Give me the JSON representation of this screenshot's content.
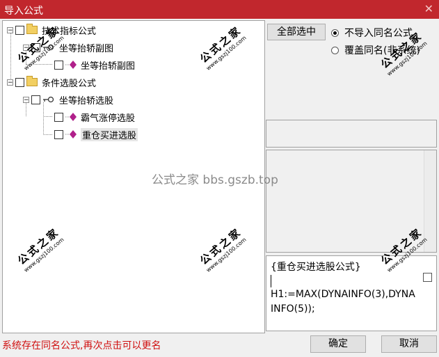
{
  "window": {
    "title": "导入公式",
    "close_glyph": "✕"
  },
  "tree": {
    "nodes": [
      {
        "label": "技术指标公式"
      },
      {
        "label": "坐等抬轿副图"
      },
      {
        "label": "坐等抬轿副图"
      },
      {
        "label": "条件选股公式"
      },
      {
        "label": "坐等抬轿选股"
      },
      {
        "label": "霸气涨停选股"
      },
      {
        "label": "重仓买进选股"
      }
    ]
  },
  "options": {
    "select_all_label": "全部选中",
    "radio_skip_label": "不导入同名公式",
    "radio_overwrite_label": "覆盖同名(非系统)"
  },
  "formula_preview": {
    "line1": "{重仓买进选股公式}",
    "line2": "H1:=MAX(DYNAINFO(3),DYNAINFO(5));"
  },
  "status": {
    "message": "系统存在同名公式,再次点击可以更名"
  },
  "buttons": {
    "ok_label": "确定",
    "cancel_label": "取消"
  },
  "watermark": {
    "center_text": "公式之家 bbs.gszb.top",
    "stamp_big": "公式之家",
    "stamp_small": "www.gszj100.com"
  },
  "colors": {
    "titlebar": "#c1272d",
    "status_text": "#d01010",
    "gem_color": "#b0208a"
  }
}
